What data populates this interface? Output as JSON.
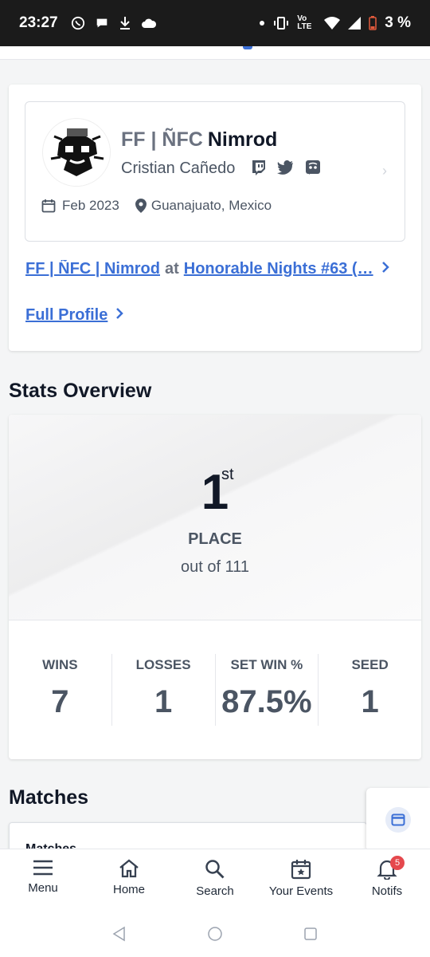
{
  "status_bar": {
    "time": "23:27",
    "network": "Vo LTE",
    "battery": "3 %"
  },
  "profile": {
    "prefix": "FF | ÑFC",
    "gamer_tag": "Nimrod",
    "real_name": "Cristian Cañedo",
    "socials": [
      "twitch-icon",
      "twitter-icon",
      "discord-icon"
    ],
    "date": "Feb 2023",
    "location": "Guanajuato, Mexico",
    "event_link": {
      "entrant": "FF | ÑFC | Nimrod",
      "at": "at",
      "event": "Honorable Nights #63 (…"
    },
    "full_profile_label": "Full Profile"
  },
  "stats": {
    "section_title": "Stats Overview",
    "place": "1",
    "place_suffix": "st",
    "place_label": "PLACE",
    "out_of": "out of 111",
    "items": [
      {
        "label": "WINS",
        "value": "7"
      },
      {
        "label": "LOSSES",
        "value": "1"
      },
      {
        "label": "SET WIN %",
        "value": "87.5%"
      },
      {
        "label": "SEED",
        "value": "1"
      }
    ]
  },
  "matches": {
    "section_title": "Matches",
    "sub_label": "Matches"
  },
  "bottom_nav": {
    "items": [
      {
        "label": "Menu",
        "icon": "menu-icon"
      },
      {
        "label": "Home",
        "icon": "home-icon"
      },
      {
        "label": "Search",
        "icon": "search-icon"
      },
      {
        "label": "Your Events",
        "icon": "calendar-star-icon"
      },
      {
        "label": "Notifs",
        "icon": "bell-icon"
      }
    ],
    "notif_count": "5"
  },
  "colors": {
    "link": "#3b6fd6",
    "badge": "#e5484d",
    "status_bar_bg": "#1b1b1b"
  }
}
